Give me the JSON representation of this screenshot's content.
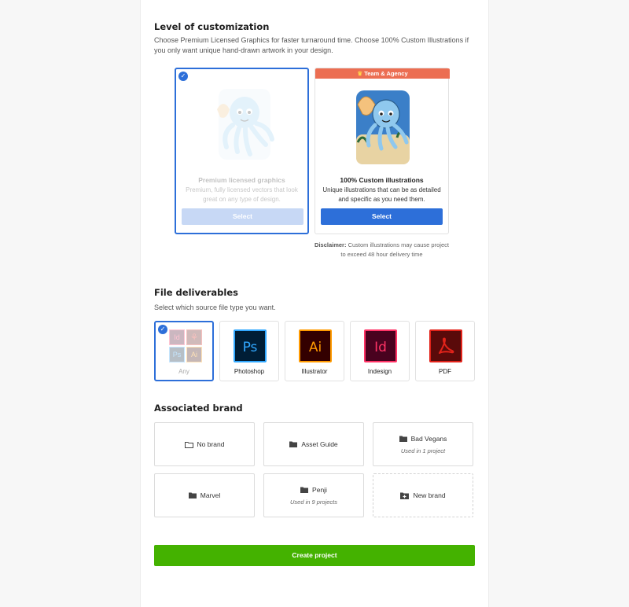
{
  "customization": {
    "heading": "Level of customization",
    "description": "Choose Premium Licensed Graphics for faster turnaround time. Choose 100% Custom Illustrations if you only want unique hand-drawn artwork in your design.",
    "options": [
      {
        "title": "Premium licensed graphics",
        "description": "Premium, fully licensed vectors that look great on any type of design.",
        "button": "Select",
        "selected": true
      },
      {
        "badge": "Team & Agency",
        "title": "100% Custom illustrations",
        "description": "Unique illustrations that can be as detailed and specific as you need them.",
        "button": "Select",
        "selected": false
      }
    ],
    "disclaimer_label": "Disclaimer:",
    "disclaimer_text": "Custom illustrations may cause project to exceed 48 hour delivery time"
  },
  "deliverables": {
    "heading": "File deliverables",
    "description": "Select which source file type you want.",
    "options": [
      {
        "label": "Any",
        "selected": true,
        "mini_icons": [
          "Id",
          "",
          "Ps",
          "Ai"
        ]
      },
      {
        "label": "Photoshop",
        "icon_text": "Ps"
      },
      {
        "label": "Illustrator",
        "icon_text": "Ai"
      },
      {
        "label": "Indesign",
        "icon_text": "Id"
      },
      {
        "label": "PDF"
      }
    ]
  },
  "brand": {
    "heading": "Associated brand",
    "options": [
      {
        "label": "No brand",
        "icon": "folder-outline-icon"
      },
      {
        "label": "Asset Guide",
        "icon": "folder-icon"
      },
      {
        "label": "Bad Vegans",
        "icon": "folder-icon",
        "sub": "Used in 1 project"
      },
      {
        "label": "Marvel",
        "icon": "folder-icon"
      },
      {
        "label": "Penji",
        "icon": "folder-icon",
        "sub": "Used in 9 projects"
      },
      {
        "label": "New brand",
        "icon": "folder-plus-icon"
      }
    ]
  },
  "create_button": "Create project",
  "colors": {
    "accent": "#2d6fd9",
    "create": "#44b200",
    "badge": "#ec6e52",
    "photoshop": "#31a8ff",
    "illustrator": "#ff9a00",
    "indesign": "#ff3366",
    "pdf": "#e2231a"
  }
}
